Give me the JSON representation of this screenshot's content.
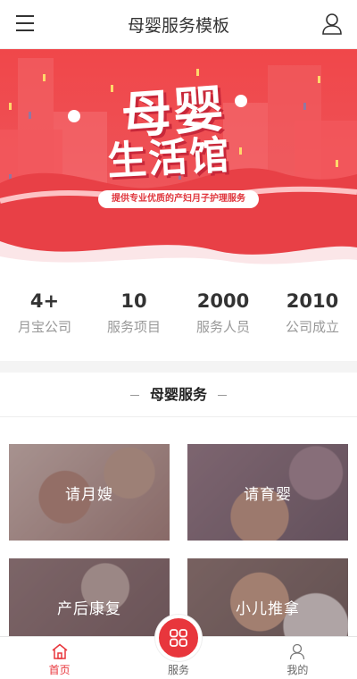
{
  "header": {
    "title": "母婴服务模板",
    "menu_icon": "menu-icon",
    "user_icon": "user-icon"
  },
  "banner": {
    "line1": "母婴",
    "line2": "生活馆",
    "tagline": "提供专业优质的产妇月子护理服务",
    "accent_color": "#ee4a4f"
  },
  "stats": [
    {
      "value": "4+",
      "label": "月宝公司"
    },
    {
      "value": "10",
      "label": "服务项目"
    },
    {
      "value": "2000",
      "label": "服务人员"
    },
    {
      "value": "2010",
      "label": "公司成立"
    }
  ],
  "section": {
    "title": "母婴服务"
  },
  "services": [
    {
      "label": "请月嫂"
    },
    {
      "label": "请育婴"
    },
    {
      "label": "产后康复"
    },
    {
      "label": "小儿推拿"
    }
  ],
  "tabbar": {
    "active_color": "#e8363c",
    "items": [
      {
        "label": "首页",
        "icon": "home-icon"
      },
      {
        "label": "服务",
        "icon": "grid-icon"
      },
      {
        "label": "我的",
        "icon": "user-icon"
      }
    ]
  }
}
